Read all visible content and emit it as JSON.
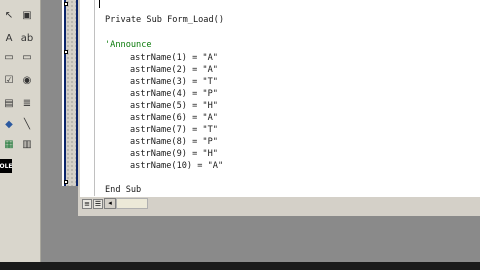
{
  "toolbox": {
    "tools": [
      {
        "name": "pointer-icon",
        "glyph": "↖"
      },
      {
        "name": "picturebox-icon",
        "glyph": "▣"
      },
      {
        "name": "label-icon",
        "glyph": "A"
      },
      {
        "name": "textbox-icon",
        "glyph": "ab"
      },
      {
        "name": "frame-icon",
        "glyph": "▭"
      },
      {
        "name": "commandbutton-icon",
        "glyph": "▭"
      },
      {
        "name": "checkbox-icon",
        "glyph": "☑"
      },
      {
        "name": "optionbutton-icon",
        "glyph": "◉"
      },
      {
        "name": "combobox-icon",
        "glyph": "▤"
      },
      {
        "name": "listbox-icon",
        "glyph": "≣"
      },
      {
        "name": "hscrollbar-icon",
        "glyph": "◂▸"
      },
      {
        "name": "vscrollbar-icon",
        "glyph": "▴"
      },
      {
        "name": "timer-icon",
        "glyph": "◷"
      },
      {
        "name": "drivelist-icon",
        "glyph": "▬"
      },
      {
        "name": "dirlist-icon",
        "glyph": "▭"
      },
      {
        "name": "filelist-icon",
        "glyph": "▤"
      },
      {
        "name": "shape-icon",
        "glyph": "◆"
      },
      {
        "name": "line-icon",
        "glyph": "╲"
      },
      {
        "name": "image-icon",
        "glyph": "▦"
      },
      {
        "name": "data-icon",
        "glyph": "▥"
      },
      {
        "name": "ole-icon",
        "glyph": "OLE"
      }
    ]
  },
  "code": {
    "sub_header": "Private Sub Form_Load()",
    "comment": "'Announce",
    "assignments": [
      "astrName(1) = \"A\"",
      "astrName(2) = \"A\"",
      "astrName(3) = \"T\"",
      "astrName(4) = \"P\"",
      "astrName(5) = \"H\"",
      "astrName(6) = \"A\"",
      "astrName(7) = \"T\"",
      "astrName(8) = \"P\"",
      "astrName(9) = \"H\"",
      "astrName(10) = \"A\""
    ],
    "end_sub": "End Sub"
  },
  "bottom_bar": {
    "procedure_view_glyph": "≡",
    "module_view_glyph": "☰",
    "scroll_left_glyph": "◂"
  }
}
